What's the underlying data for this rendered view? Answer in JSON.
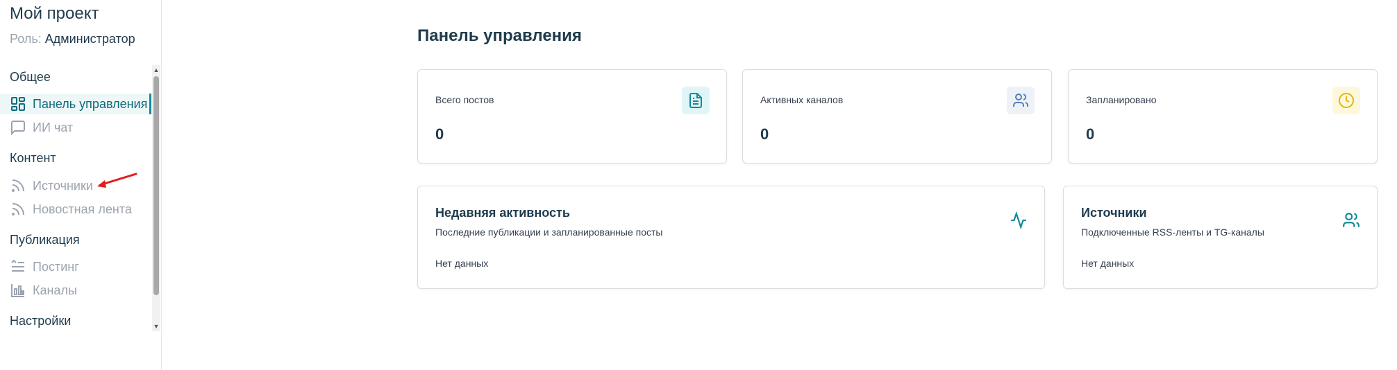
{
  "sidebar": {
    "project_title": "Мой проект",
    "role_label": "Роль:",
    "role_value": "Администратор",
    "sections": {
      "general": "Общее",
      "content": "Контент",
      "publishing": "Публикация",
      "settings": "Настройки"
    },
    "items": {
      "dashboard": {
        "label": "Панель управления",
        "icon": "grid-icon"
      },
      "ai_chat": {
        "label": "ИИ чат",
        "icon": "chat-bubble-icon"
      },
      "sources": {
        "label": "Источники",
        "icon": "rss-icon"
      },
      "news_feed": {
        "label": "Новостная лента",
        "icon": "rss-icon"
      },
      "posting": {
        "label": "Постинг",
        "icon": "text-align-icon"
      },
      "channels": {
        "label": "Каналы",
        "icon": "bar-chart-icon"
      }
    }
  },
  "main": {
    "page_title": "Панель управления",
    "stats": [
      {
        "label": "Всего постов",
        "value": "0",
        "icon": "document-icon"
      },
      {
        "label": "Активных каналов",
        "value": "0",
        "icon": "users-icon"
      },
      {
        "label": "Запланировано",
        "value": "0",
        "icon": "clock-icon"
      }
    ],
    "recent_activity": {
      "title": "Недавняя активность",
      "subtitle": "Последние публикации и запланированные посты",
      "empty": "Нет данных",
      "icon": "activity-icon"
    },
    "sources_card": {
      "title": "Источники",
      "subtitle": "Подключенные RSS-ленты и TG-каналы",
      "empty": "Нет данных",
      "icon": "users-icon"
    }
  },
  "colors": {
    "accent": "#0f8a99",
    "text_dark": "#1f3b4d",
    "muted": "#9ca3af",
    "icon_doc_bg": "#e0f5f6",
    "icon_users_bg": "#eef2f6",
    "icon_clock_bg": "#fdf7dc",
    "annotation": "#e11d1d"
  }
}
